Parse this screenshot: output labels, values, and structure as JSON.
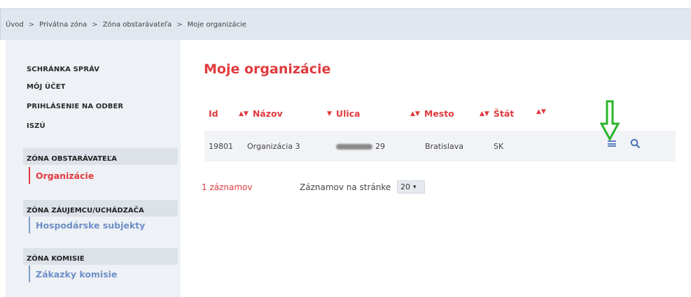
{
  "breadcrumb": {
    "items": [
      "Úvod",
      "Privátna zóna",
      "Zóna obstarávateľa",
      "Moje organizácie"
    ],
    "separator": ">"
  },
  "sidebar": {
    "links": [
      "SCHRÁNKA SPRÁV",
      "MÔJ ÚČET",
      "PRIHLÁSENIE NA ODBER",
      "ISZÚ"
    ],
    "zones": [
      {
        "heading": "ZÓNA OBSTARÁVATEĽA",
        "item": "Organizácie",
        "active": true
      },
      {
        "heading": "ZÓNA ZÁUJEMCU/UCHÁDZAČA",
        "item": "Hospodárske subjekty",
        "active": false
      },
      {
        "heading": "ZÓNA KOMISIE",
        "item": "Zákazky komisie",
        "active": false
      }
    ]
  },
  "main": {
    "title": "Moje organizácie",
    "columns": [
      "Id",
      "Názov",
      "Ulica",
      "Mesto",
      "Štát"
    ],
    "row": {
      "id": "19801",
      "name": "Organizácia 3",
      "street_number": "29",
      "city": "Bratislava",
      "country": "SK"
    },
    "footer": {
      "count": "1 záznamov",
      "per_page_label": "Záznamov na stránke",
      "per_page_value": "20"
    }
  },
  "colors": {
    "accent": "#e03a3e",
    "link": "#6d8fc7",
    "annotation_arrow": "#2bb52b"
  }
}
